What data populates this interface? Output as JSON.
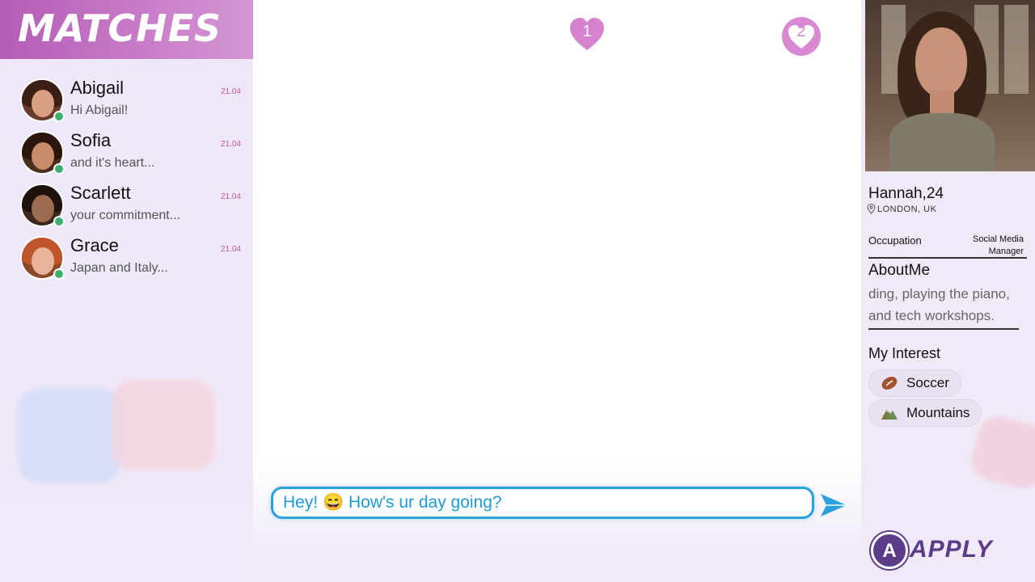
{
  "sidebar": {
    "title": "MATCHES",
    "matches": [
      {
        "name": "Abigail",
        "preview": "Hi Abigail!",
        "date": "21.04",
        "online": true
      },
      {
        "name": "Sofia",
        "preview": "and it's heart...",
        "date": "21.04",
        "online": true
      },
      {
        "name": "Scarlett",
        "preview": "your commitment...",
        "date": "21.04",
        "online": true
      },
      {
        "name": "Grace",
        "preview": "Japan and Italy...",
        "date": "21.04",
        "online": true
      }
    ]
  },
  "chat": {
    "markers": [
      "1",
      "2"
    ],
    "input_text": "Hey! 😄 How's ur day going?"
  },
  "profile": {
    "name_age": "Hannah,24",
    "location": "LONDON, UK",
    "occupation_label": "Occupation",
    "occupation_value": "Social Media Manager",
    "about_title": "AboutMe",
    "about_text": "ding, playing the piano, and tech workshops.",
    "interest_title": "My Interest",
    "interests": [
      {
        "label": "Soccer",
        "icon": "football-icon"
      },
      {
        "label": "Mountains",
        "icon": "mountain-icon"
      }
    ]
  },
  "brand": {
    "logo_letter": "A",
    "name": "APPLY"
  },
  "colors": {
    "accent_pink": "#c97ec9",
    "online_green": "#3eb06b",
    "chat_blue": "#2aa0dc",
    "brand_purple": "#5b3c89"
  }
}
